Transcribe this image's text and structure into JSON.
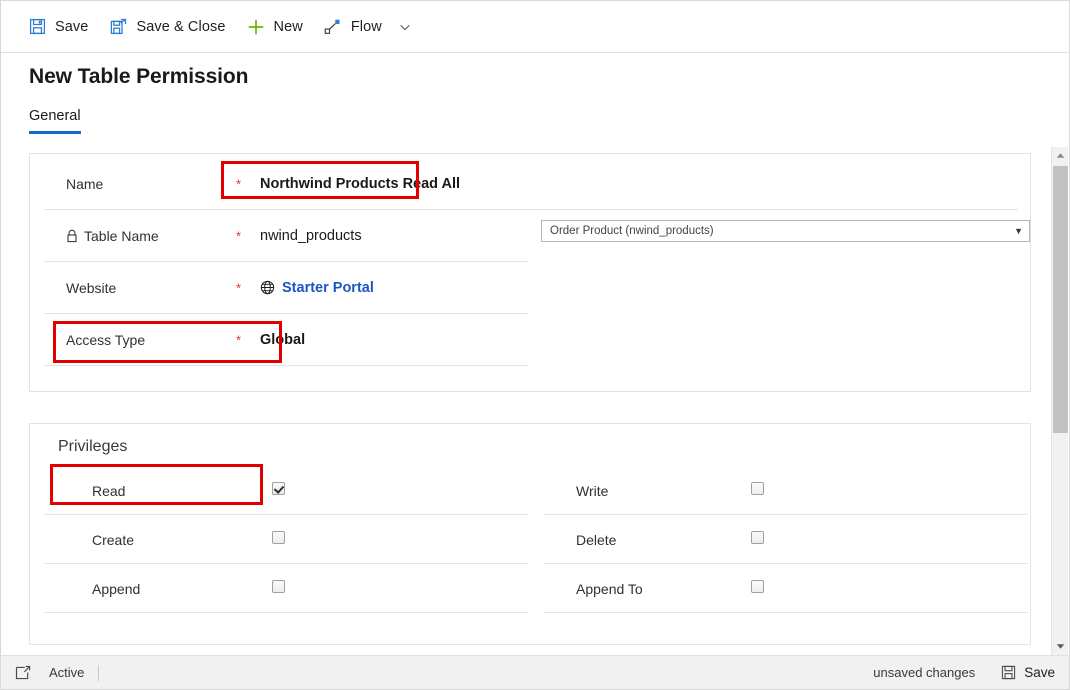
{
  "commandbar": {
    "buttons": [
      {
        "id": "save",
        "label": "Save",
        "icon": "save-icon"
      },
      {
        "id": "save-close",
        "label": "Save & Close",
        "icon": "save-and-close-icon"
      },
      {
        "id": "new",
        "label": "New",
        "icon": "plus-icon"
      },
      {
        "id": "flow",
        "label": "Flow",
        "icon": "flow-icon"
      }
    ],
    "caret_icon": "chevron-down-icon"
  },
  "header": {
    "title": "New Table Permission",
    "tabs": [
      {
        "id": "general",
        "label": "General",
        "active": true
      }
    ]
  },
  "general": {
    "rows": [
      {
        "id": "name",
        "label": "Name",
        "required": "*",
        "value": "Northwind Products Read All",
        "bold": true,
        "locked": false,
        "highlighted": true
      },
      {
        "id": "table-name",
        "label": "Table Name",
        "required": "*",
        "value": "nwind_products",
        "bold": false,
        "locked": true,
        "highlighted": false
      },
      {
        "id": "website",
        "label": "Website",
        "required": "*",
        "value": "Starter Portal",
        "bold": true,
        "link": true,
        "icon": "globe-icon",
        "locked": false,
        "highlighted": false
      },
      {
        "id": "access-type",
        "label": "Access Type",
        "required": "*",
        "value": "Global",
        "bold": true,
        "locked": false,
        "highlighted": true
      }
    ],
    "table_lookup": {
      "value": "Order Product (nwind_products)",
      "arrow_icon": "dropdown-arrow-icon"
    }
  },
  "privileges": {
    "heading": "Privileges",
    "left_column": [
      {
        "id": "read",
        "label": "Read",
        "checked": true,
        "highlighted": true
      },
      {
        "id": "create",
        "label": "Create",
        "checked": false,
        "highlighted": false
      },
      {
        "id": "append",
        "label": "Append",
        "checked": false,
        "highlighted": false
      }
    ],
    "right_column": [
      {
        "id": "write",
        "label": "Write",
        "checked": false
      },
      {
        "id": "delete",
        "label": "Delete",
        "checked": false
      },
      {
        "id": "append-to",
        "label": "Append To",
        "checked": false
      }
    ]
  },
  "statusbar": {
    "icon": "popout-icon",
    "state": "Active",
    "unsaved": "unsaved changes",
    "save_label": "Save",
    "save_icon": "save-icon"
  },
  "colors": {
    "accent_blue": "#1968d2",
    "link_blue": "#1a57c4",
    "annotation_red": "#e10000",
    "required_red": "#e03030",
    "new_green": "#6bb700"
  }
}
